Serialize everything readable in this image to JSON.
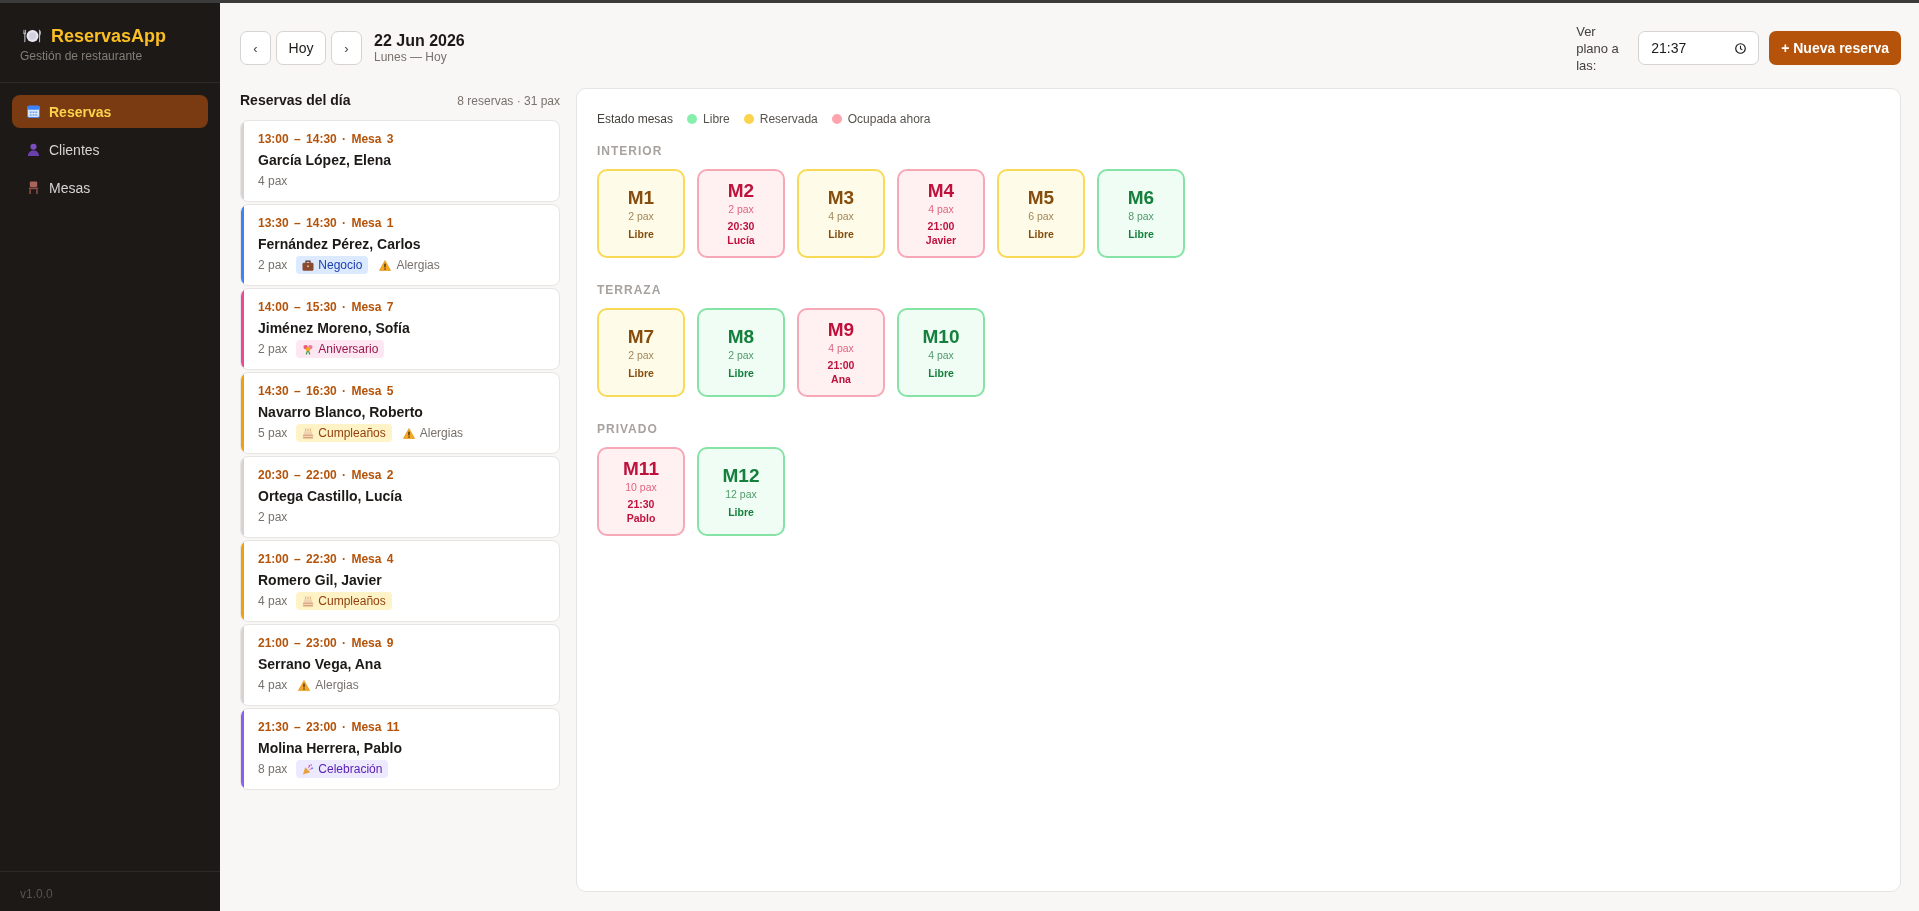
{
  "sidebar": {
    "brand": "ReservasApp",
    "subtitle": "Gestión de restaurante",
    "items": [
      {
        "label": "Reservas",
        "selected": true
      },
      {
        "label": "Clientes",
        "selected": false
      },
      {
        "label": "Mesas",
        "selected": false
      }
    ],
    "version": "v1.0.0"
  },
  "header": {
    "prev": "‹",
    "today": "Hoy",
    "next": "›",
    "date": "22 Jun 2026",
    "day": "Lunes — Hoy",
    "time_label": "Ver plano a las:",
    "time_value": "21:37",
    "new_button": "+ Nueva reserva"
  },
  "reservations": {
    "title": "Reservas del día",
    "summary": "8 reservas · 31 pax",
    "items": [
      {
        "slot": "13:00 – 14:30 · Mesa 3",
        "name": "García López, Elena",
        "pax": "4 pax",
        "color": "#d6d3d1"
      },
      {
        "slot": "13:30 – 14:30 · Mesa 1",
        "name": "Fernández Pérez, Carlos",
        "pax": "2 pax",
        "color": "#3b82f6",
        "tags": [
          {
            "kind": "business",
            "label": "Negocio"
          },
          {
            "kind": "allergy",
            "label": "Alergias"
          }
        ]
      },
      {
        "slot": "14:00 – 15:30 · Mesa 7",
        "name": "Jiménez Moreno, Sofía",
        "pax": "2 pax",
        "color": "#ec4899",
        "tags": [
          {
            "kind": "anniversary",
            "label": "Aniversario"
          }
        ]
      },
      {
        "slot": "14:30 – 16:30 · Mesa 5",
        "name": "Navarro Blanco, Roberto",
        "pax": "5 pax",
        "color": "#f59e0b",
        "tags": [
          {
            "kind": "birthday",
            "label": "Cumpleaños"
          },
          {
            "kind": "allergy",
            "label": "Alergias"
          }
        ]
      },
      {
        "slot": "20:30 – 22:00 · Mesa 2",
        "name": "Ortega Castillo, Lucía",
        "pax": "2 pax",
        "color": "#d6d3d1"
      },
      {
        "slot": "21:00 – 22:30 · Mesa 4",
        "name": "Romero Gil, Javier",
        "pax": "4 pax",
        "color": "#f59e0b",
        "tags": [
          {
            "kind": "birthday",
            "label": "Cumpleaños"
          }
        ]
      },
      {
        "slot": "21:00 – 23:00 · Mesa 9",
        "name": "Serrano Vega, Ana",
        "pax": "4 pax",
        "color": "#d6d3d1",
        "tags": [
          {
            "kind": "allergy",
            "label": "Alergias"
          }
        ]
      },
      {
        "slot": "21:30 – 23:00 · Mesa 11",
        "name": "Molina Herrera, Pablo",
        "pax": "8 pax",
        "color": "#8b5cf6",
        "tags": [
          {
            "kind": "celebration",
            "label": "Celebración"
          }
        ]
      }
    ]
  },
  "floor": {
    "title": "Estado mesas",
    "legend": [
      {
        "label": "Libre",
        "color": "#86efac"
      },
      {
        "label": "Reservada",
        "color": "#fcd34d"
      },
      {
        "label": "Ocupada ahora",
        "color": "#fda4af"
      }
    ],
    "sections": [
      {
        "name": "INTERIOR",
        "tables": [
          {
            "id": "M1",
            "seats": "2 pax",
            "kind": "reserved",
            "label": "Libre"
          },
          {
            "id": "M2",
            "seats": "2 pax",
            "kind": "occupied",
            "time": "20:30",
            "guest": "Lucía"
          },
          {
            "id": "M3",
            "seats": "4 pax",
            "kind": "reserved",
            "label": "Libre"
          },
          {
            "id": "M4",
            "seats": "4 pax",
            "kind": "occupied",
            "time": "21:00",
            "guest": "Javier"
          },
          {
            "id": "M5",
            "seats": "6 pax",
            "kind": "reserved",
            "label": "Libre"
          },
          {
            "id": "M6",
            "seats": "8 pax",
            "kind": "free",
            "label": "Libre"
          }
        ]
      },
      {
        "name": "TERRAZA",
        "tables": [
          {
            "id": "M7",
            "seats": "2 pax",
            "kind": "reserved",
            "label": "Libre"
          },
          {
            "id": "M8",
            "seats": "2 pax",
            "kind": "free",
            "label": "Libre"
          },
          {
            "id": "M9",
            "seats": "4 pax",
            "kind": "occupied",
            "time": "21:00",
            "guest": "Ana"
          },
          {
            "id": "M10",
            "seats": "4 pax",
            "kind": "free",
            "label": "Libre"
          }
        ]
      },
      {
        "name": "PRIVADO",
        "tables": [
          {
            "id": "M11",
            "seats": "10 pax",
            "kind": "occupied",
            "time": "21:30",
            "guest": "Pablo"
          },
          {
            "id": "M12",
            "seats": "12 pax",
            "kind": "free",
            "label": "Libre"
          }
        ]
      }
    ]
  }
}
